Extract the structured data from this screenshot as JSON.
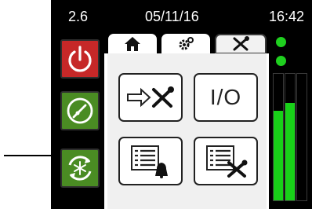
{
  "status": {
    "left": "2.6",
    "date": "05/11/16",
    "time": "16:42"
  },
  "sidebar": [
    {
      "name": "power-icon",
      "color": "#c62828"
    },
    {
      "name": "gauge-icon",
      "color": "#4a8c23"
    },
    {
      "name": "snowflake-cycle-icon",
      "color": "#4a8c23"
    }
  ],
  "tabs": [
    {
      "icon": "home-icon"
    },
    {
      "icon": "gear-icon"
    },
    {
      "icon": "tools-icon",
      "active": true
    }
  ],
  "menu": {
    "service_icon": "arrow-tools-icon",
    "io_label": "I/O",
    "log_user_icon": "list-bell-icon",
    "log_service_icon": "list-tools-icon"
  },
  "indicators": {
    "leds": [
      "on",
      "on"
    ],
    "bar_levels": [
      0.71,
      0.77,
      0.0
    ]
  },
  "accent_color": "#18d118"
}
